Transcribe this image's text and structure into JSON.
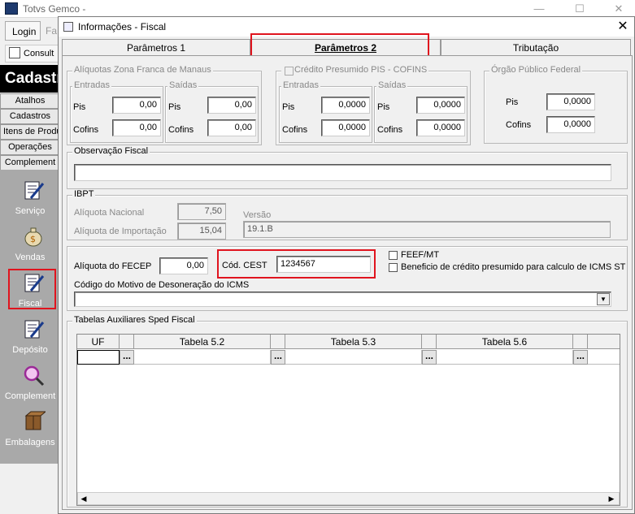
{
  "background": {
    "app_title": "Totvs Gemco -",
    "login_label": "Login",
    "menu_fa": "Fa",
    "consult_label": "Consult",
    "section_title": "Cadastr",
    "nav": [
      "Atalhos",
      "Cadastros",
      "Itens de Produ",
      "Operações",
      "Complement"
    ],
    "sidebar_items": [
      "Serviço",
      "Vendas",
      "Fiscal",
      "Depósito",
      "Complement",
      "Embalagens"
    ]
  },
  "dialog": {
    "title": "Informações  - Fiscal",
    "tabs": [
      "Parâmetros 1",
      "Parâmetros 2",
      "Tributação"
    ],
    "active_tab": "Parâmetros 2",
    "zona_franca": {
      "title": "Alíquotas Zona Franca de Manaus",
      "entradas_title": "Entradas",
      "saidas_title": "Saídas",
      "pis_label": "Pis",
      "cofins_label": "Cofins",
      "entradas_pis": "0,00",
      "entradas_cofins": "0,00",
      "saidas_pis": "0,00",
      "saidas_cofins": "0,00"
    },
    "credito_presumido": {
      "title": "Crédito Presumido PIS - COFINS",
      "checked": false,
      "entradas_title": "Entradas",
      "saidas_title": "Saídas",
      "pis_label": "Pis",
      "cofins_label": "Cofins",
      "entradas_pis": "0,0000",
      "entradas_cofins": "0,0000",
      "saidas_pis": "0,0000",
      "saidas_cofins": "0,0000"
    },
    "orgao_publico": {
      "title": "Órgão Público Federal",
      "pis_label": "Pis",
      "cofins_label": "Cofins",
      "pis": "0,0000",
      "cofins": "0,0000"
    },
    "observacao": {
      "title": "Observação Fiscal",
      "value": ""
    },
    "ibpt": {
      "title": "IBPT",
      "nacional_label": "Alíquota Nacional",
      "nacional_value": "7,50",
      "importacao_label": "Alíquota de Importação",
      "importacao_value": "15,04",
      "versao_label": "Versão",
      "versao_value": "19.1.B"
    },
    "fecep": {
      "label": "Alíquota do FECEP",
      "value": "0,00",
      "cest_label": "Cód. CEST",
      "cest_value": "1234567",
      "feef_label": "FEEF/MT",
      "beneficio_label": "Beneficio de crédito presumido para calculo de ICMS ST",
      "desoneracao_label": "Código do Motivo de Desoneração do ICMS",
      "desoneracao_value": ""
    },
    "sped": {
      "title": "Tabelas Auxiliares Sped Fiscal",
      "columns": [
        "UF",
        "Tabela 5.2",
        "Tabela 5.3",
        "Tabela 5.6"
      ],
      "ellipsis": "..."
    }
  },
  "colors": {
    "highlight": "#e0141e",
    "sidebar": "#a9a9a9"
  }
}
